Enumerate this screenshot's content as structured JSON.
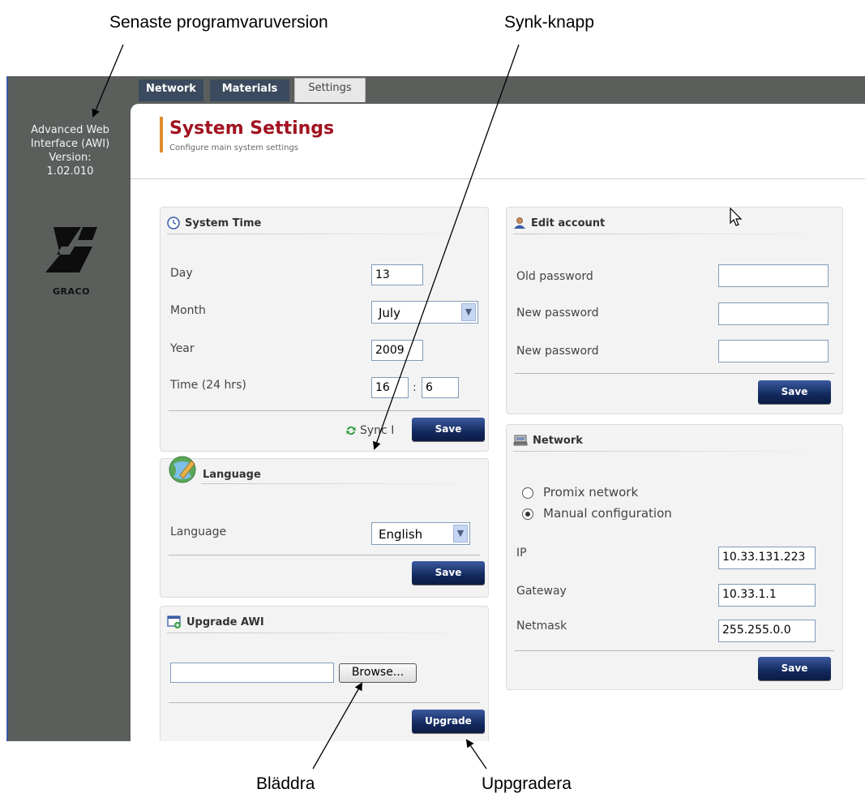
{
  "callouts": {
    "software_version": "Senaste programvaruversion",
    "sync_button": "Synk-knapp",
    "browse": "Bläddra",
    "upgrade": "Uppgradera"
  },
  "sidebar": {
    "line1": "Advanced Web",
    "line2": "Interface (AWI)",
    "line3": "Version:",
    "line4": "1.02.010",
    "logo_text": "GRACO"
  },
  "tabs": [
    {
      "label": "Network",
      "active": false
    },
    {
      "label": "Materials",
      "active": false
    },
    {
      "label": "Settings",
      "active": true
    }
  ],
  "header": {
    "title": "System Settings",
    "subtitle": "Configure main system settings"
  },
  "system_time": {
    "title": "System Time",
    "day_label": "Day",
    "day_value": "13",
    "month_label": "Month",
    "month_value": "July",
    "year_label": "Year",
    "year_value": "2009",
    "time_label": "Time (24 hrs)",
    "hour_value": "16",
    "time_sep": ":",
    "minute_value": "6",
    "sync_label": "Sync I",
    "save_label": "Save"
  },
  "language": {
    "title": "Language",
    "label": "Language",
    "value": "English",
    "save_label": "Save"
  },
  "upgrade": {
    "title": "Upgrade AWI",
    "file_value": "",
    "browse_label": "Browse...",
    "upgrade_label": "Upgrade"
  },
  "edit_account": {
    "title": "Edit account",
    "old_password_label": "Old password",
    "new_password_label": "New password",
    "confirm_password_label": "New password",
    "save_label": "Save"
  },
  "network": {
    "title": "Network",
    "option_promix": "Promix network",
    "option_manual": "Manual configuration",
    "selected": "Manual configuration",
    "ip_label": "IP",
    "ip_value": "10.33.131.223",
    "gateway_label": "Gateway",
    "gateway_value": "10.33.1.1",
    "netmask_label": "Netmask",
    "netmask_value": "255.255.0.0",
    "save_label": "Save"
  },
  "colors": {
    "title_red": "#a1121f",
    "button_navy": "#132a5e",
    "sidebar_gray": "#5b5f5c",
    "accent_orange": "#e08a2c"
  }
}
